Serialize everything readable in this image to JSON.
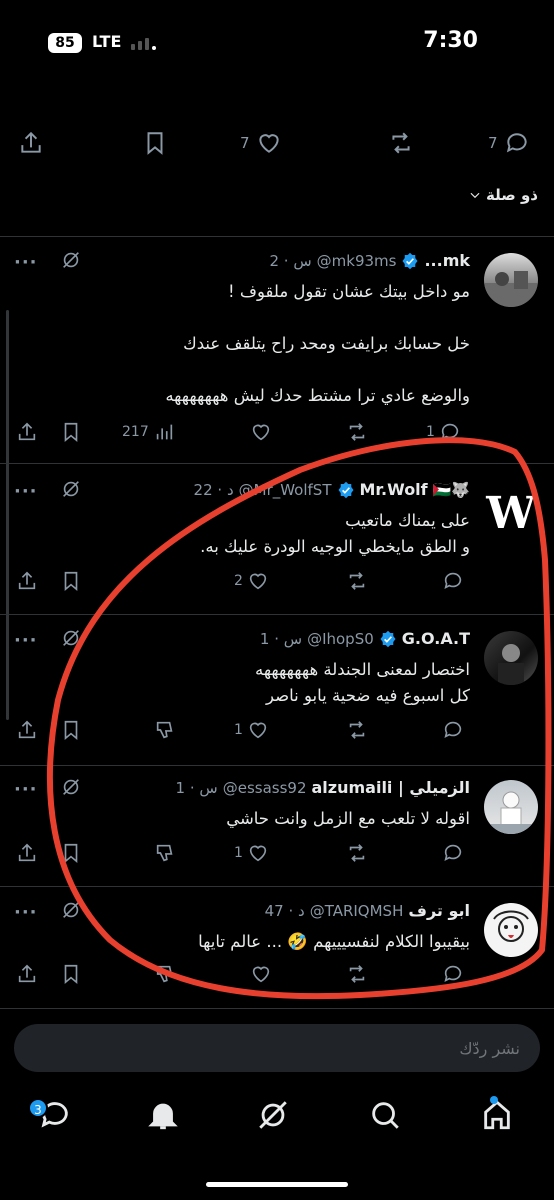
{
  "status": {
    "battery": "85",
    "network": "LTE",
    "time": "7:30"
  },
  "main_actions": {
    "replies": "7",
    "likes": "7"
  },
  "sort_label": "ذو صلة",
  "replies": [
    {
      "name": "mk...",
      "handle": "@mk93ms",
      "time": "2 · س",
      "verified": true,
      "text": "مو داخل بيتك عشان تقول ملقوف !\n\nخل حسابك برايفت ومحد راح يتلقف عندك\n\nوالوضع عادي ترا مشتط حدك ليش هههههههه",
      "replies": "1",
      "likes": "",
      "views": "217"
    },
    {
      "name": "Mr.Wolf",
      "emoji": "🐺🇵🇸",
      "handle": "@Mr_WolfST",
      "time": "22 · د",
      "verified": true,
      "text": "على يمناك ماتعيب\nو الطق مايخطي الوجيه الودرة عليك به.",
      "replies": "",
      "likes": "2"
    },
    {
      "name": "G.O.A.T",
      "handle": "@IhopS0",
      "time": "1 · س",
      "verified": true,
      "text": "اختصار لمعنى الجندلة هههههههه\nكل اسبوع فيه ضحية يابو ناصر",
      "replies": "",
      "likes": "1"
    },
    {
      "name": "الزميلي | alzumaili",
      "handle": "@essass92",
      "time": "1 · س",
      "verified": false,
      "text": "اقوله لا تلعب مع الزمل وانت حاشي",
      "replies": "",
      "likes": "1"
    },
    {
      "name": "ابو ترف",
      "handle": "@TARIQMSH",
      "time": "47 · د",
      "verified": false,
      "text": "بيقيبوا الكلام لنفسيييهم 🤣 ... عالم تايها",
      "replies": "",
      "likes": ""
    }
  ],
  "composer": {
    "placeholder": "نشر ردّك"
  },
  "nav": {
    "messages_badge": "3"
  },
  "colors": {
    "accent": "#1d9bf0",
    "annotation": "#e8402f"
  }
}
